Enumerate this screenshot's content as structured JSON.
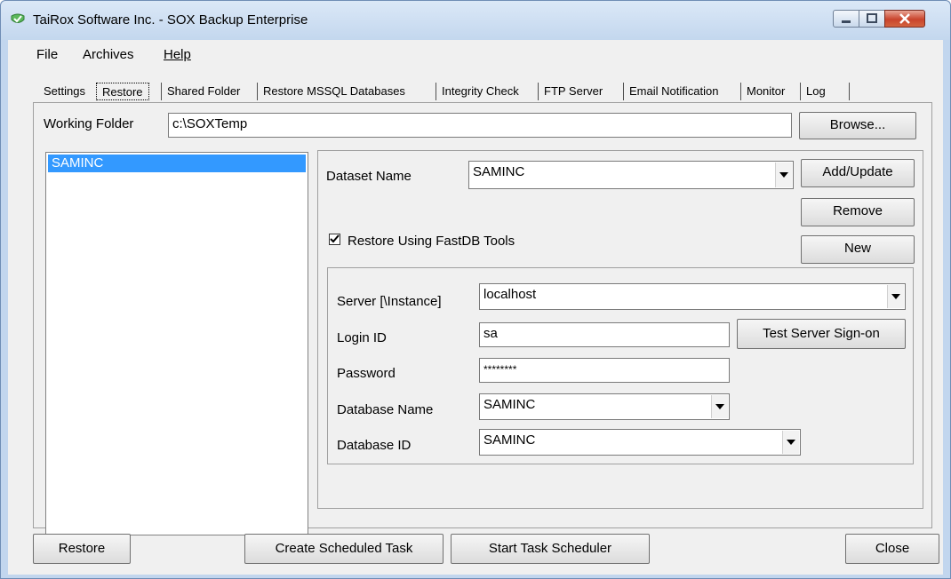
{
  "window": {
    "title": "TaiRox Software Inc. - SOX Backup Enterprise",
    "controls": [
      "minimize",
      "maximize",
      "close"
    ]
  },
  "menu": {
    "items": [
      "File",
      "Archives",
      "Help"
    ]
  },
  "tabs": [
    {
      "label": "Settings"
    },
    {
      "label": "Restore",
      "active": true
    },
    {
      "label": "Shared Folder"
    },
    {
      "label": "Restore MSSQL Databases"
    },
    {
      "label": "Integrity Check"
    },
    {
      "label": "FTP Server"
    },
    {
      "label": "Email Notification"
    },
    {
      "label": "Monitor"
    },
    {
      "label": "Log"
    }
  ],
  "working_folder": {
    "label": "Working Folder",
    "value": "c:\\SOXTemp",
    "browse_label": "Browse..."
  },
  "datasets": {
    "items": [
      "SAMINC"
    ],
    "selected": "SAMINC"
  },
  "dataset": {
    "name_label": "Dataset Name",
    "name_value": "SAMINC",
    "add_update_label": "Add/Update",
    "remove_label": "Remove",
    "new_label": "New",
    "fastdb_label": "Restore Using FastDB Tools",
    "fastdb_checked": true
  },
  "server": {
    "server_label": "Server [\\Instance]",
    "server_value": "localhost",
    "login_label": "Login ID",
    "login_value": "sa",
    "test_label": "Test Server Sign-on",
    "password_label": "Password",
    "password_value": "********",
    "dbname_label": "Database Name",
    "dbname_value": "SAMINC",
    "dbid_label": "Database ID",
    "dbid_value": "SAMINC"
  },
  "footer": {
    "restore_label": "Restore",
    "create_task_label": "Create Scheduled Task",
    "start_scheduler_label": "Start Task Scheduler",
    "close_label": "Close"
  },
  "colors": {
    "selection": "#3399ff",
    "frame": "#c2d6ee",
    "close_button": "#c9442c"
  }
}
